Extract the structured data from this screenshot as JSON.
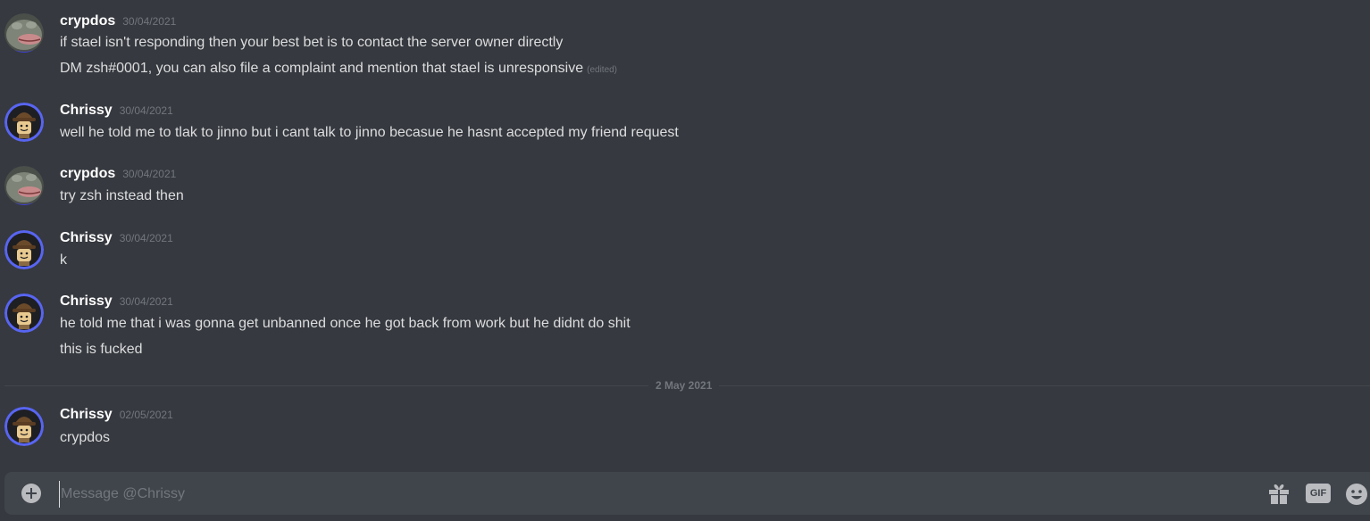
{
  "channel": {
    "recipient": "Chrissy"
  },
  "messages": [
    {
      "author": "crypdos",
      "timestamp": "30/04/2021",
      "avatar": "frog-avatar",
      "lines": [
        {
          "text": "if stael isn't responding then your best bet is to contact the server owner directly",
          "edited": ""
        },
        {
          "text": "DM zsh#0001, you can also file a complaint and mention that stael is unresponsive",
          "edited": "(edited)"
        }
      ]
    },
    {
      "author": "Chrissy",
      "timestamp": "30/04/2021",
      "avatar": "lego-figure-avatar",
      "lines": [
        {
          "text": "well he told me to tlak to jinno but i cant talk to jinno becasue he hasnt accepted my friend request",
          "edited": ""
        }
      ]
    },
    {
      "author": "crypdos",
      "timestamp": "30/04/2021",
      "avatar": "frog-avatar",
      "lines": [
        {
          "text": "try zsh instead then",
          "edited": ""
        }
      ]
    },
    {
      "author": "Chrissy",
      "timestamp": "30/04/2021",
      "avatar": "lego-figure-avatar",
      "lines": [
        {
          "text": "k",
          "edited": ""
        }
      ]
    },
    {
      "author": "Chrissy",
      "timestamp": "30/04/2021",
      "avatar": "lego-figure-avatar",
      "lines": [
        {
          "text": "he told me that i was gonna get unbanned once he got back from work but he didnt do shit",
          "edited": ""
        },
        {
          "text": "this is fucked",
          "edited": ""
        }
      ]
    },
    {
      "author": "Chrissy",
      "timestamp": "02/05/2021",
      "avatar": "lego-figure-avatar",
      "lines": [
        {
          "text": "crypdos",
          "edited": ""
        }
      ]
    }
  ],
  "date_divider": "2 May 2021",
  "composer": {
    "placeholder": "Message @Chrissy",
    "value": "",
    "gif_label": "GIF",
    "icons": [
      "add-icon",
      "gift-icon",
      "gif-icon",
      "emoji-icon"
    ]
  },
  "colors": {
    "background": "#36393f",
    "composer": "#40444b",
    "author": "#ffffff",
    "text": "#dcddde",
    "muted": "#72767d",
    "avatar_ring": "#5865f2"
  }
}
